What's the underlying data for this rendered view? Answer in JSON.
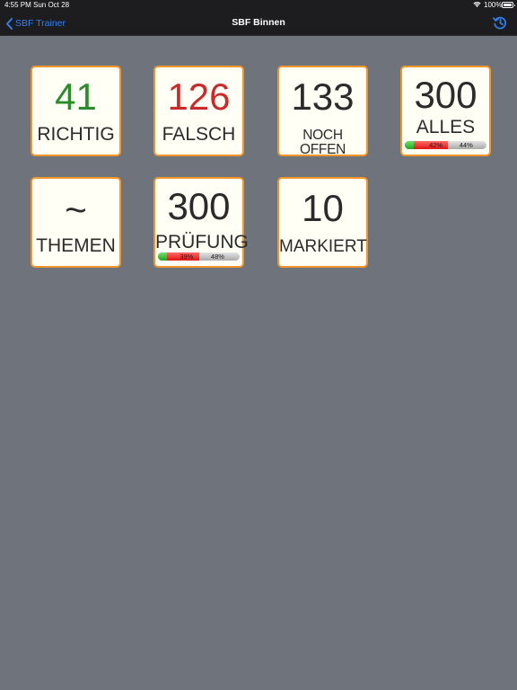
{
  "status_bar": {
    "time": "4:55 PM",
    "date": "Sun Oct 28",
    "battery": "100%"
  },
  "nav": {
    "back_label": "SBF Trainer",
    "title": "SBF Binnen",
    "accent_color": "#2f80ee"
  },
  "tiles": [
    {
      "number": "41",
      "label": "RICHTIG",
      "number_color": "#2c8c2c"
    },
    {
      "number": "126",
      "label": "FALSCH",
      "number_color": "#c92a2a"
    },
    {
      "number": "133",
      "label": "NOCH OFFEN"
    },
    {
      "number": "300",
      "label": "ALLES",
      "progress": {
        "green_fraction": 0.1,
        "red_fraction": 0.42,
        "left_text": "42%",
        "right_text": "44%"
      }
    },
    {
      "number": "~",
      "label": "THEMEN"
    },
    {
      "number": "300",
      "label": "PRÜFUNG",
      "progress": {
        "green_fraction": 0.1,
        "red_fraction": 0.39,
        "left_text": "39%",
        "right_text": "48%"
      }
    },
    {
      "number": "10",
      "label": "MARKIERT"
    }
  ],
  "colors": {
    "background": "#6f737b",
    "tile_border": "#f0962a",
    "tile_background": "#fffff5"
  },
  "icons": [
    "chevron-left-icon",
    "history-icon",
    "wifi-icon",
    "battery-icon"
  ]
}
